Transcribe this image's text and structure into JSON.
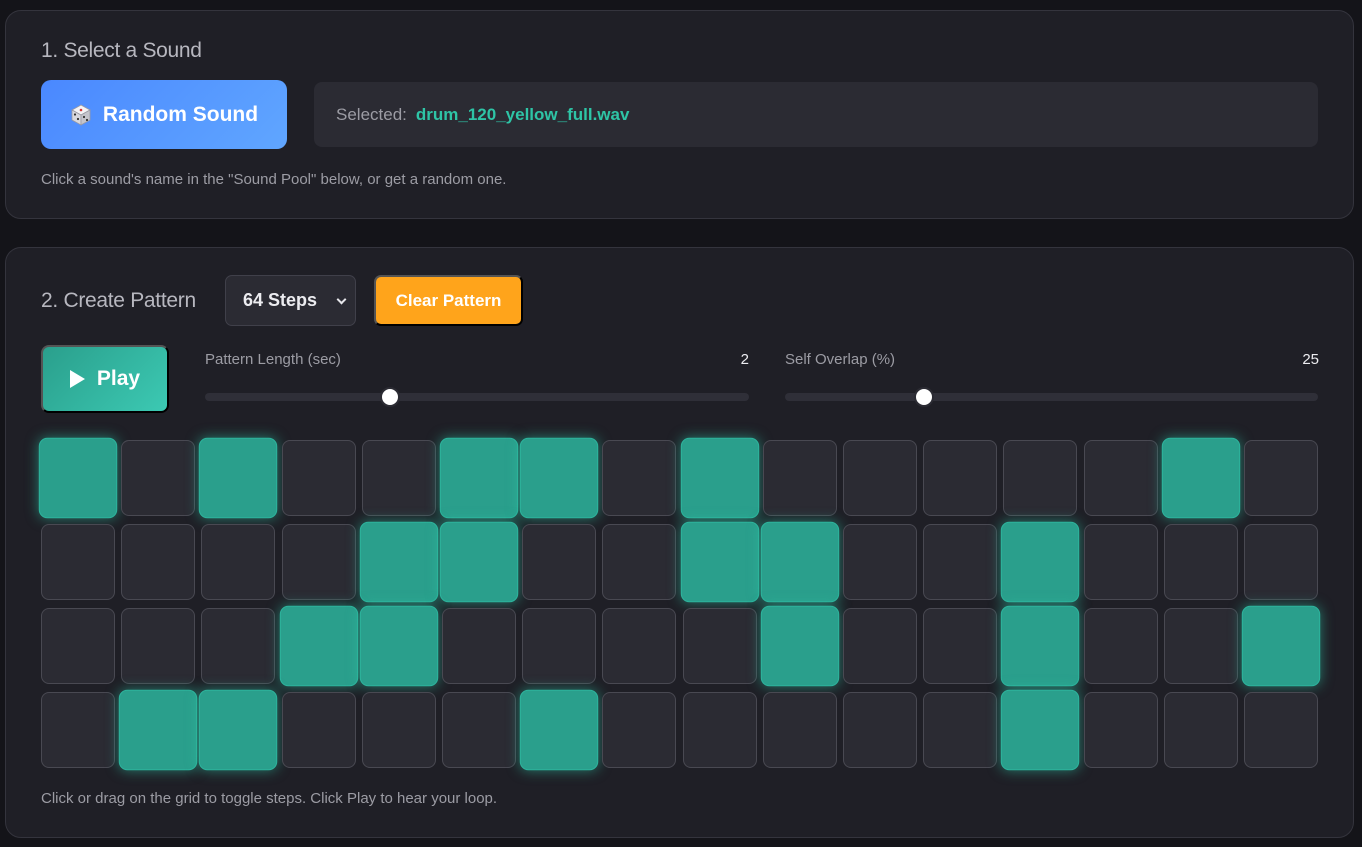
{
  "select_sound": {
    "title": "1. Select a Sound",
    "random_button": {
      "icon": "dice-icon",
      "label": "Random Sound"
    },
    "selected_label": "Selected:",
    "selected_value": "drum_120_yellow_full.wav",
    "hint": "Click a sound's name in the \"Sound Pool\" below, or get a random one."
  },
  "create_pattern": {
    "title": "2. Create Pattern",
    "steps_select": {
      "selected": "64 Steps"
    },
    "clear_button": "Clear Pattern",
    "play_button": {
      "icon": "play-icon",
      "label": "Play"
    },
    "pattern_length": {
      "label": "Pattern Length (sec)",
      "value": "2",
      "fraction": 0.34
    },
    "self_overlap": {
      "label": "Self Overlap (%)",
      "value": "25",
      "fraction": 0.26
    },
    "grid": {
      "columns": 16,
      "rows": [
        [
          1,
          0,
          1,
          0,
          0,
          1,
          1,
          0,
          1,
          0,
          0,
          0,
          0,
          0,
          1,
          0
        ],
        [
          0,
          0,
          0,
          0,
          1,
          1,
          0,
          0,
          1,
          1,
          0,
          0,
          1,
          0,
          0,
          0
        ],
        [
          0,
          0,
          0,
          1,
          1,
          0,
          0,
          0,
          0,
          1,
          0,
          0,
          1,
          0,
          0,
          1
        ],
        [
          0,
          1,
          1,
          0,
          0,
          0,
          1,
          0,
          0,
          0,
          0,
          0,
          1,
          0,
          0,
          0
        ]
      ]
    },
    "hint": "Click or drag on the grid to toggle steps. Click Play to hear your loop."
  },
  "colors": {
    "accent_teal": "#2a9f8c",
    "accent_blue": "#4a88ff",
    "accent_orange": "#ffa41b",
    "background": "#141419",
    "panel": "#1f1f26"
  }
}
